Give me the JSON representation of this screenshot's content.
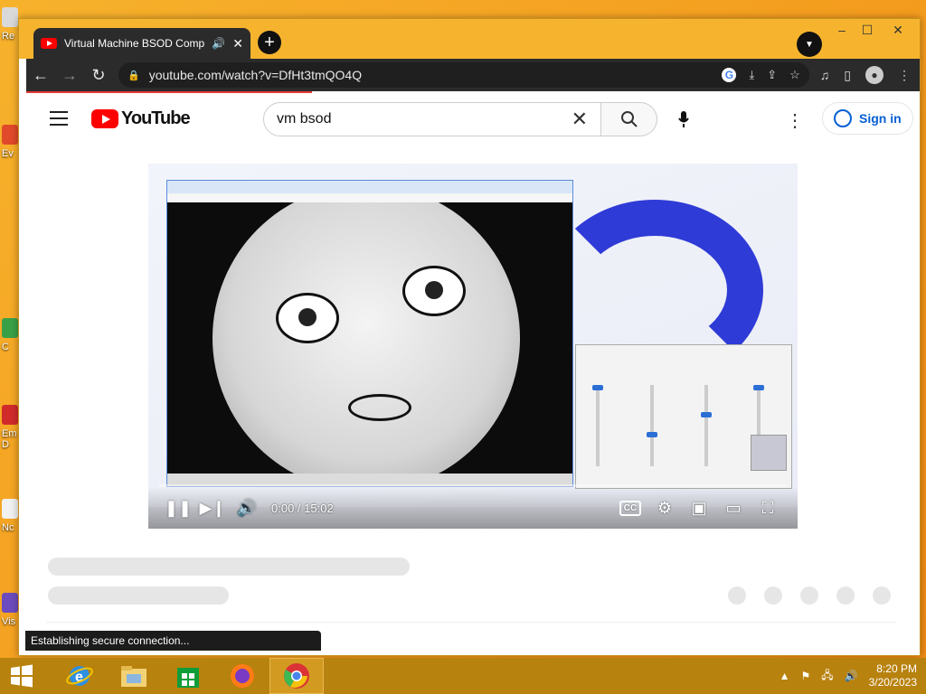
{
  "desktop": {
    "icons": [
      {
        "label": "Re"
      },
      {
        "label": "Ev"
      },
      {
        "label": "C"
      },
      {
        "label": "Em D"
      },
      {
        "label": "Nc"
      },
      {
        "label": "Vis"
      }
    ]
  },
  "browser": {
    "tab": {
      "title": "Virtual Machine BSOD Comp",
      "audio_icon": "speaker-icon",
      "close": "✕"
    },
    "new_tab": "+",
    "window_controls": {
      "minimize": "–",
      "maximize": "☐",
      "close": "✕"
    },
    "address": {
      "url": "youtube.com/watch?v=DfHt3tmQO4Q"
    }
  },
  "youtube": {
    "logo_text": "YouTube",
    "search": {
      "query": "vm bsod"
    },
    "signin_label": "Sign in"
  },
  "player": {
    "time_current": "0:00",
    "time_total": "15:02",
    "time_display": "0:00 / 15:02",
    "progress": 0.0,
    "cc_label": "CC"
  },
  "status_bubble": "Establishing secure connection...",
  "taskbar": {
    "apps": [
      {
        "name": "internet-explorer"
      },
      {
        "name": "file-explorer"
      },
      {
        "name": "store"
      },
      {
        "name": "firefox"
      },
      {
        "name": "chrome",
        "active": true
      }
    ],
    "clock_time": "8:20 PM",
    "clock_date": "3/20/2023"
  },
  "colors": {
    "accent": "#ff0000",
    "link": "#065fd4",
    "desktop": "#f39a1c",
    "taskbar": "#b8820e"
  }
}
